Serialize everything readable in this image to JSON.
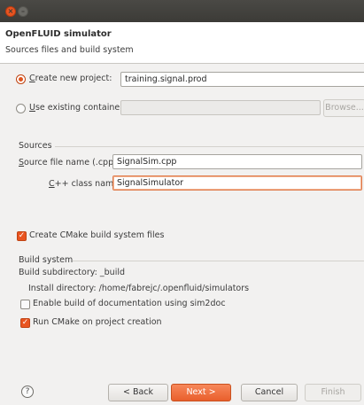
{
  "window": {
    "close_glyph": "×",
    "minimize_glyph": "–"
  },
  "header": {
    "title": "OpenFLUID simulator",
    "subtitle": "Sources files and build system"
  },
  "project": {
    "create_label_first": "C",
    "create_label_rest": "reate new project:",
    "create_value": "training.signal.prod",
    "use_label_first": "U",
    "use_label_rest": "se existing container:",
    "use_value": "",
    "browse_label": "Browse..."
  },
  "sources": {
    "group_label": "Sources",
    "file_label_first": "S",
    "file_label_rest": "ource file name (.cpp):",
    "file_value": "SignalSim.cpp",
    "class_label_first": "C",
    "class_label_rest": "++ class name:",
    "class_value": "SignalSimulator"
  },
  "cmake": {
    "create_label": "Create CMake build system files",
    "create_checked": true
  },
  "build": {
    "group_label": "Build system",
    "subdir_text": "Build subdirectory: _build",
    "install_text": "Install directory: /home/fabrejc/.openfluid/simulators",
    "doc_label": "Enable build of documentation using sim2doc",
    "doc_checked": false,
    "run_label": "Run CMake on project creation",
    "run_checked": true
  },
  "footer": {
    "help_glyph": "?",
    "back_label": "< Back",
    "next_label": "Next >",
    "cancel_label": "Cancel",
    "finish_label": "Finish"
  },
  "colors": {
    "accent": "#e95420",
    "titlebar": "#3c3b37",
    "background": "#f2f1f0"
  }
}
